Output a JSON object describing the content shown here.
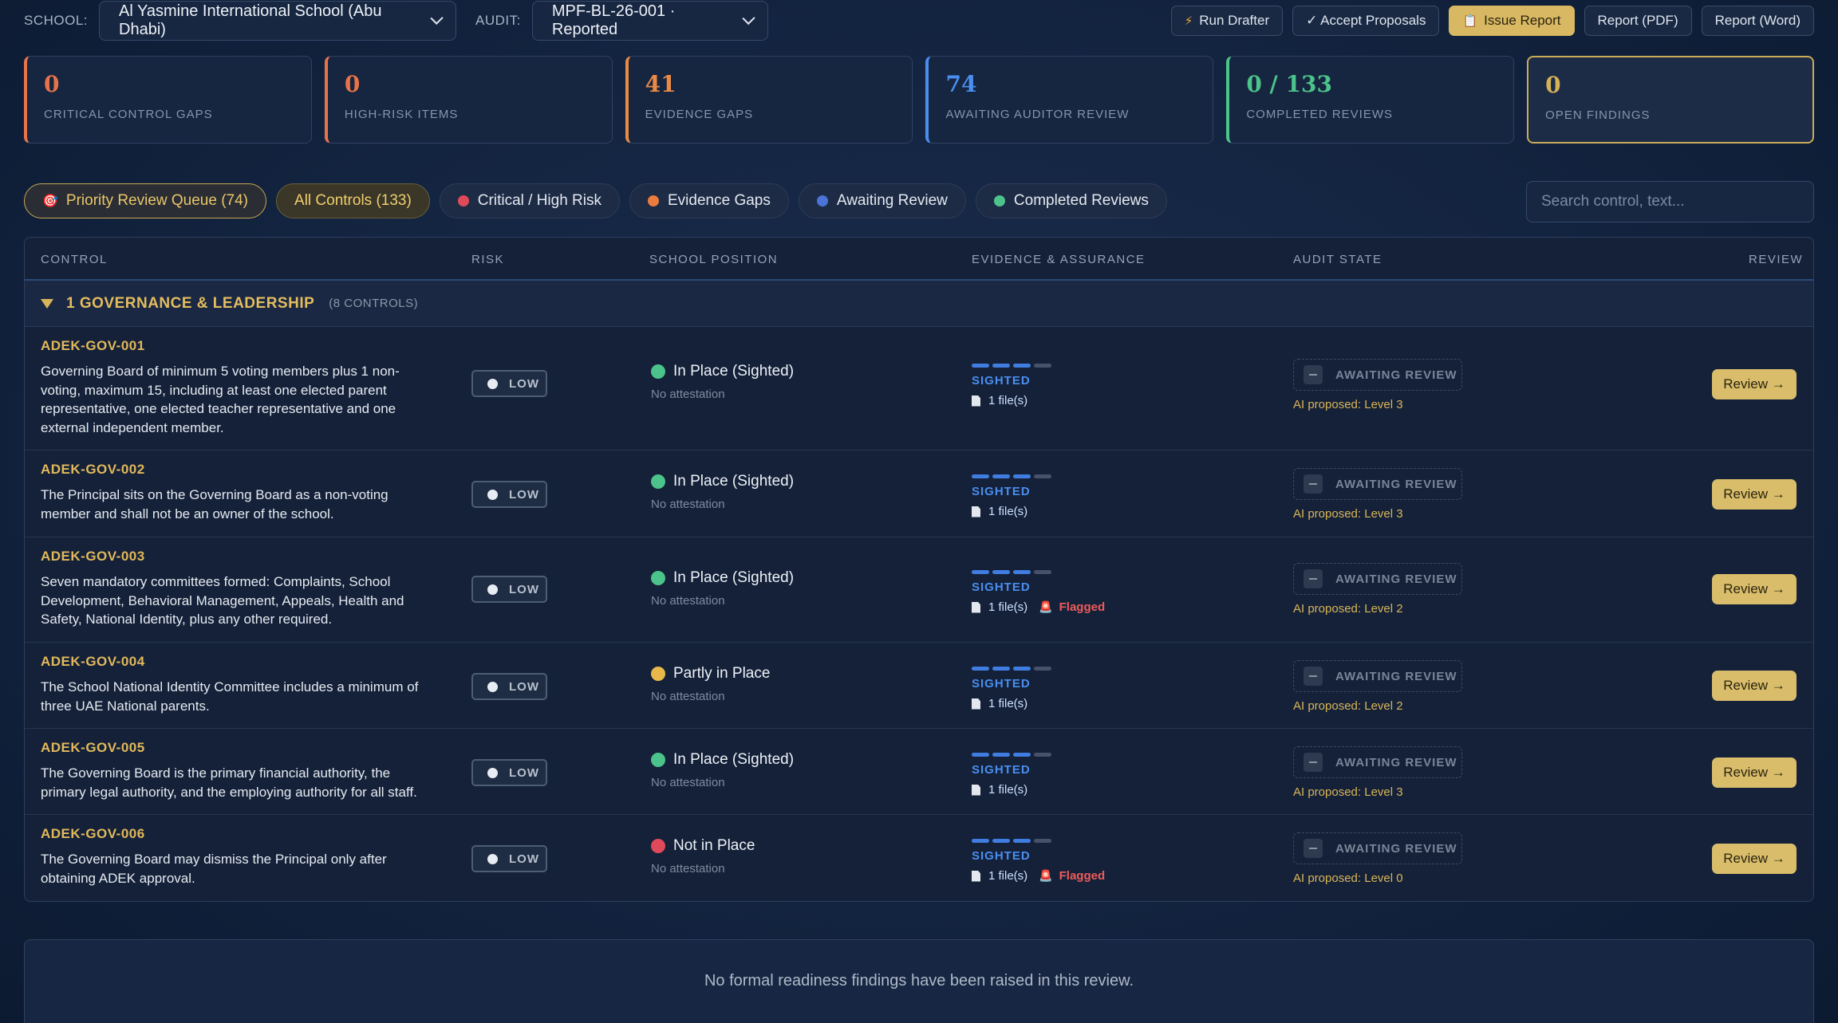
{
  "topbar": {
    "school_label": "SCHOOL:",
    "school_value": "Al Yasmine International School (Abu Dhabi)",
    "audit_label": "AUDIT:",
    "audit_value": "MPF-BL-26-001 · Reported",
    "buttons": {
      "run_drafter": "Run Drafter",
      "accept_proposals": "✓ Accept Proposals",
      "issue_report": "Issue Report",
      "report_pdf": "Report (PDF)",
      "report_word": "Report (Word)"
    }
  },
  "cards": [
    {
      "value": "0",
      "caption": "CRITICAL CONTROL GAPS",
      "color": "#e8734a"
    },
    {
      "value": "0",
      "caption": "HIGH-RISK ITEMS",
      "color": "#e8734a"
    },
    {
      "value": "41",
      "caption": "EVIDENCE GAPS",
      "color": "#ec8a45"
    },
    {
      "value": "74",
      "caption": "AWAITING AUDITOR REVIEW",
      "color": "#4a8ef0"
    },
    {
      "value": "0 / 133",
      "caption": "COMPLETED REVIEWS",
      "color": "#4cc38a"
    },
    {
      "value": "0",
      "caption": "OPEN FINDINGS",
      "color": "#d6b257"
    }
  ],
  "filters": {
    "priority": "Priority Review Queue (74)",
    "all": "All Controls (133)",
    "critical": "Critical / High Risk",
    "evidence": "Evidence Gaps",
    "awaiting": "Awaiting Review",
    "completed": "Completed Reviews"
  },
  "search": {
    "placeholder": "Search control, text..."
  },
  "table": {
    "headers": {
      "control": "CONTROL",
      "risk": "RISK",
      "position": "SCHOOL POSITION",
      "evidence": "EVIDENCE & ASSURANCE",
      "audit": "AUDIT STATE",
      "review": "REVIEW"
    },
    "group": {
      "name": "1 GOVERNANCE & LEADERSHIP",
      "count": "(8 CONTROLS)"
    },
    "rows": [
      {
        "id": "ADEK-GOV-001",
        "line1": "Governing Board of minimum 5 voting members plus 1 non-",
        "line2": "voting, maximum 15, including at least one elected parent",
        "line3": "representative, one elected teacher representative and one",
        "line4": "external independent member.",
        "risk": "LOW",
        "position": "In Place (Sighted)",
        "attestation": "No attestation",
        "evidence": "SIGHTED",
        "files": "1 file(s)",
        "flag": "",
        "audit": "AWAITING REVIEW",
        "proposal": "AI proposed: Level 3",
        "review": "Review →"
      },
      {
        "id": "ADEK-GOV-002",
        "line1": "The Principal sits on the Governing Board as a non-voting",
        "line2": "member and shall not be an owner of the school.",
        "risk": "LOW",
        "position": "In Place (Sighted)",
        "attestation": "No attestation",
        "evidence": "SIGHTED",
        "files": "1 file(s)",
        "flag": "",
        "audit": "AWAITING REVIEW",
        "proposal": "AI proposed: Level 3",
        "review": "Review →"
      },
      {
        "id": "ADEK-GOV-003",
        "line1": "Seven mandatory committees formed: Complaints, School",
        "line2": "Development, Behavioral Management, Appeals, Health and",
        "line3": "Safety, National Identity, plus any other required.",
        "risk": "LOW",
        "position": "In Place (Sighted)",
        "attestation": "No attestation",
        "evidence": "SIGHTED",
        "files": "1 file(s)",
        "flag": "Flagged",
        "audit": "AWAITING REVIEW",
        "proposal": "AI proposed: Level 2",
        "review": "Review →"
      },
      {
        "id": "ADEK-GOV-004",
        "line1": "The School National Identity Committee includes a minimum of",
        "line2": "three UAE National parents.",
        "risk": "LOW",
        "position": "Partly in Place",
        "attestation": "No attestation",
        "evidence": "SIGHTED",
        "files": "1 file(s)",
        "flag": "",
        "audit": "AWAITING REVIEW",
        "proposal": "AI proposed: Level 2",
        "review": "Review →"
      },
      {
        "id": "ADEK-GOV-005",
        "line1": "The Governing Board is the primary financial authority, the",
        "line2": "primary legal authority, and the employing authority for all staff.",
        "risk": "LOW",
        "position": "In Place (Sighted)",
        "attestation": "No attestation",
        "evidence": "SIGHTED",
        "files": "1 file(s)",
        "flag": "",
        "audit": "AWAITING REVIEW",
        "proposal": "AI proposed: Level 3",
        "review": "Review →"
      },
      {
        "id": "ADEK-GOV-006",
        "line1": "The Governing Board may dismiss the Principal only after",
        "line2": "obtaining ADEK approval.",
        "risk": "LOW",
        "position": "Not in Place",
        "attestation": "No attestation",
        "evidence": "SIGHTED",
        "files": "1 file(s)",
        "flag": "Flagged",
        "audit": "AWAITING REVIEW",
        "proposal": "AI proposed: Level 0",
        "review": "Review →"
      }
    ]
  },
  "findings": {
    "message": "No formal readiness findings have been raised in this review."
  },
  "colors": {
    "accent_gold": "#d9bd6a",
    "status_green": "#4cc38a",
    "status_amber": "#e8b84a",
    "status_red": "#e0495a",
    "evidence_blue": "#3f7de0",
    "flag_red": "#ef5b5b"
  },
  "icons": {
    "run_drafter": "lightning-icon",
    "issue_report": "clipboard-icon",
    "priority": "target-icon",
    "file": "document-icon",
    "flag": "alarm-icon"
  }
}
